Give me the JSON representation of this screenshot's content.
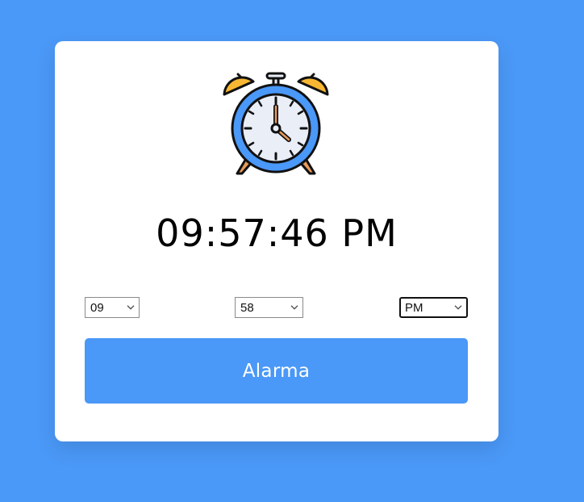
{
  "clock": {
    "time_display": "09:57:46 PM",
    "icon": "alarm-clock-icon"
  },
  "selects": {
    "hour": "09",
    "minute": "58",
    "ampm": "PM"
  },
  "button": {
    "label": "Alarma"
  },
  "colors": {
    "background": "#4a98f7",
    "card": "#ffffff",
    "button": "#4a98f7",
    "bell": "#f7b733",
    "clock_ring": "#4a98f7",
    "clock_face": "#e9eef7"
  }
}
